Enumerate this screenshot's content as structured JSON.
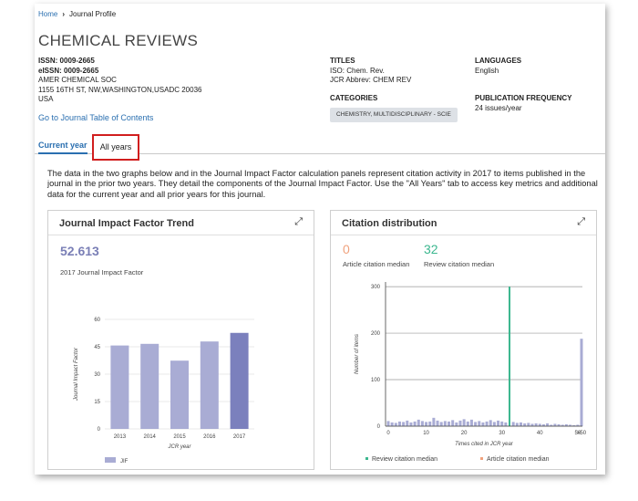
{
  "breadcrumb": {
    "home": "Home",
    "separator": "›",
    "current": "Journal Profile"
  },
  "journal": {
    "title": "CHEMICAL REVIEWS",
    "issn": "ISSN: 0009-2665",
    "eissn": "eISSN: 0009-2665",
    "publisher": "AMER CHEMICAL SOC",
    "address": "1155 16TH ST, NW,WASHINGTON,USADC 20036",
    "country": "USA",
    "toc_link": "Go to Journal Table of Contents"
  },
  "titles": {
    "heading": "TITLES",
    "iso": "ISO: Chem. Rev.",
    "jcr_abbrev": "JCR Abbrev: CHEM REV"
  },
  "categories": {
    "heading": "CATEGORIES",
    "chip": "CHEMISTRY, MULTIDISCIPLINARY - SCIE"
  },
  "languages": {
    "heading": "LANGUAGES",
    "value": "English"
  },
  "frequency": {
    "heading": "PUBLICATION FREQUENCY",
    "value": "24 issues/year"
  },
  "tabs": {
    "current": "Current year",
    "all": "All years"
  },
  "description": "The data in the two graphs below and in the Journal Impact Factor calculation panels represent citation activity in 2017 to items published in the journal in the prior two years. They detail the components of the Journal Impact Factor. Use the \"All Years\" tab to access key metrics and additional data for the current year and all prior years for this journal.",
  "jif_panel": {
    "title": "Journal Impact Factor Trend",
    "value": "52.613",
    "label": "2017 Journal Impact Factor",
    "expand_icon": "expand-icon"
  },
  "cit_panel": {
    "title": "Citation distribution",
    "article_median": "0",
    "article_median_label": "Article citation median",
    "review_median": "32",
    "review_median_label": "Review citation median",
    "expand_icon": "expand-icon"
  },
  "colors": {
    "link": "#2a6fb0",
    "bar": "#a9acd4",
    "bar_highlight": "#7b80bd",
    "review": "#3cb78f",
    "article": "#f0a27d",
    "tab_highlight": "#d11e1e"
  },
  "chart_data": [
    {
      "type": "bar",
      "categories": [
        "2013",
        "2014",
        "2015",
        "2016",
        "2017"
      ],
      "values": [
        45.7,
        46.6,
        37.4,
        47.9,
        52.613
      ],
      "xlabel": "JCR year",
      "ylabel": "Journal Impact Factor",
      "yticks": [
        "0",
        "15",
        "30",
        "45",
        "60"
      ],
      "ylim": [
        0,
        60
      ],
      "legend": [
        "JIF"
      ]
    },
    {
      "type": "bar",
      "x": [
        "0",
        "1",
        "2",
        "3",
        "4",
        "5",
        "6",
        "7",
        "8",
        "9",
        "10",
        "11",
        "12",
        "13",
        "14",
        "15",
        "16",
        "17",
        "18",
        "19",
        "20",
        "21",
        "22",
        "23",
        "24",
        "25",
        "26",
        "27",
        "28",
        "29",
        "30",
        "31",
        "32",
        "33",
        "34",
        "35",
        "36",
        "37",
        "38",
        "39",
        "40",
        "41",
        "42",
        "43",
        "44",
        "45",
        "46",
        "47",
        "48",
        "49",
        "50",
        ">50"
      ],
      "values": [
        11,
        8,
        7,
        10,
        9,
        12,
        8,
        10,
        14,
        11,
        9,
        10,
        18,
        12,
        9,
        11,
        10,
        13,
        8,
        12,
        15,
        10,
        14,
        9,
        11,
        8,
        10,
        13,
        9,
        12,
        10,
        8,
        300,
        9,
        7,
        8,
        6,
        7,
        5,
        6,
        5,
        4,
        6,
        3,
        5,
        4,
        3,
        4,
        3,
        2,
        3,
        188
      ],
      "xticks": [
        "0",
        "10",
        "20",
        "30",
        "40",
        "50",
        ">50"
      ],
      "yticks": [
        "0",
        "100",
        "200",
        "300"
      ],
      "ylim": [
        0,
        310
      ],
      "xlabel": "Times cited in JCR year",
      "ylabel": "Number of items",
      "legend": [
        "Review citation median",
        "Article citation median"
      ]
    }
  ]
}
